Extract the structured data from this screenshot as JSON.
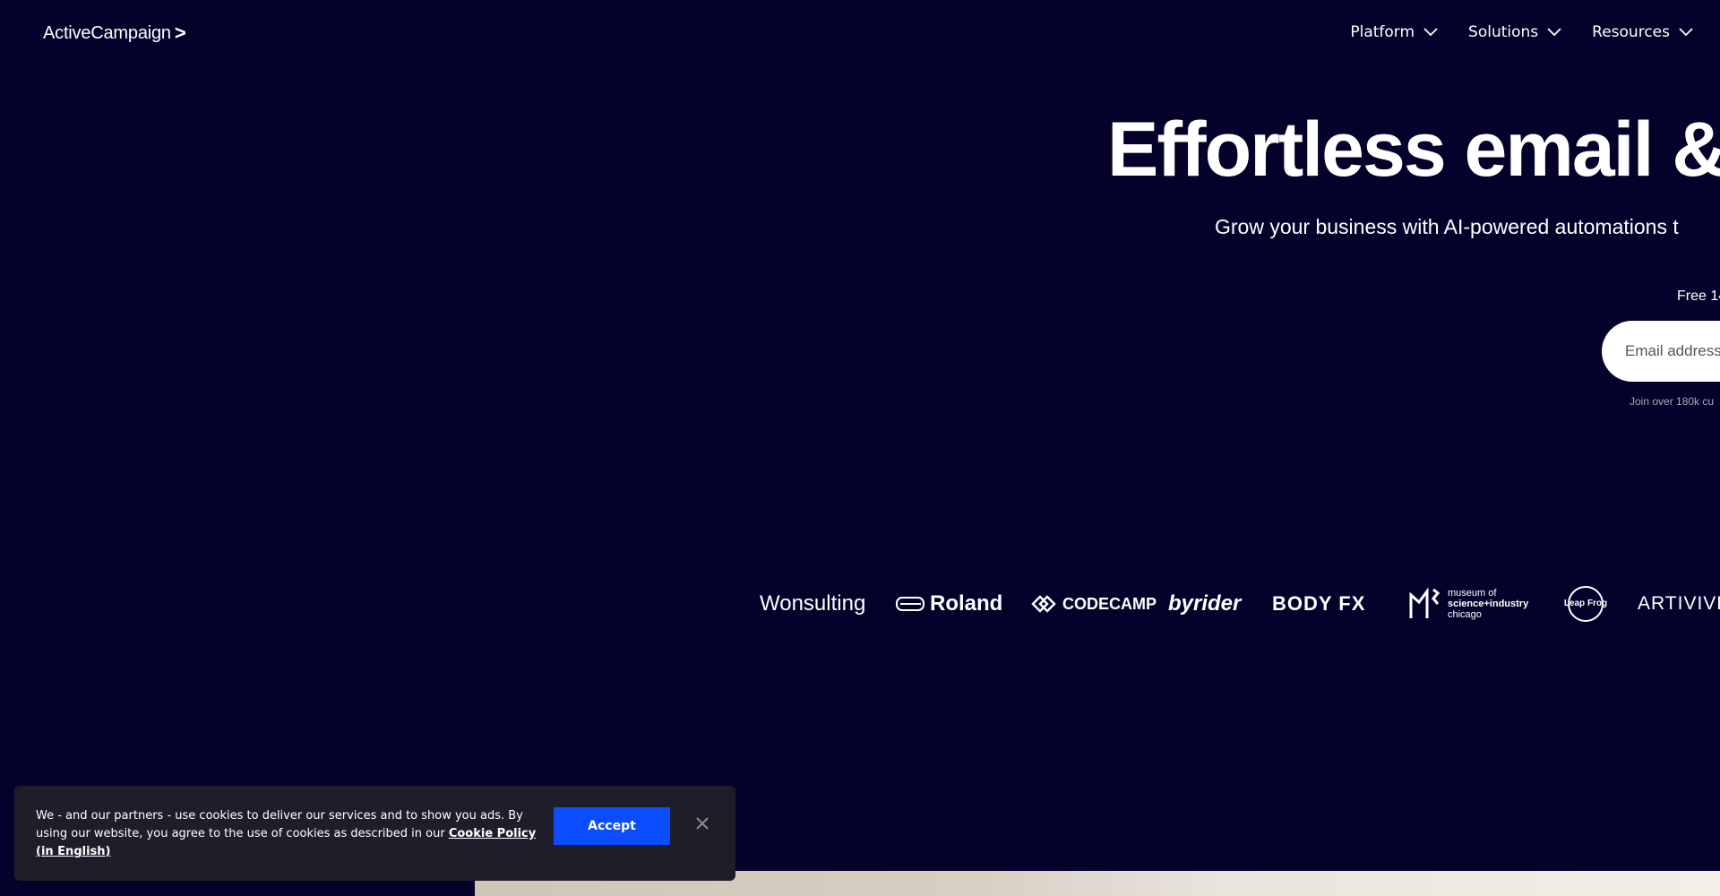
{
  "header": {
    "logo": "ActiveCampaign",
    "logo_chevron": ">",
    "nav": [
      {
        "label": "Platform"
      },
      {
        "label": "Solutions"
      },
      {
        "label": "Resources"
      }
    ]
  },
  "hero": {
    "title": "Effortless email &",
    "subtitle": "Grow your business with AI-powered automations t",
    "trial": "Free 14",
    "email_placeholder": "Email address",
    "join_text": "Join over 180k cu"
  },
  "brands": [
    {
      "name": "Wonsulting"
    },
    {
      "name": "Roland"
    },
    {
      "name": "CODECAMP"
    },
    {
      "name": "byrider"
    },
    {
      "name": "BODY FX"
    },
    {
      "name": "museum of science+industry chicago",
      "lines": [
        "museum of",
        "science+industry",
        "chicago"
      ]
    },
    {
      "name": "Leap Frog"
    },
    {
      "name": "ARTIVIVE"
    }
  ],
  "cookie_banner": {
    "text": "We - and our partners - use cookies to deliver our services and to show you ads. By using our website, you agree to the use of cookies as described in our ",
    "link_text": "Cookie Policy (in English)",
    "accept_label": "Accept",
    "close_icon": "close-icon"
  }
}
